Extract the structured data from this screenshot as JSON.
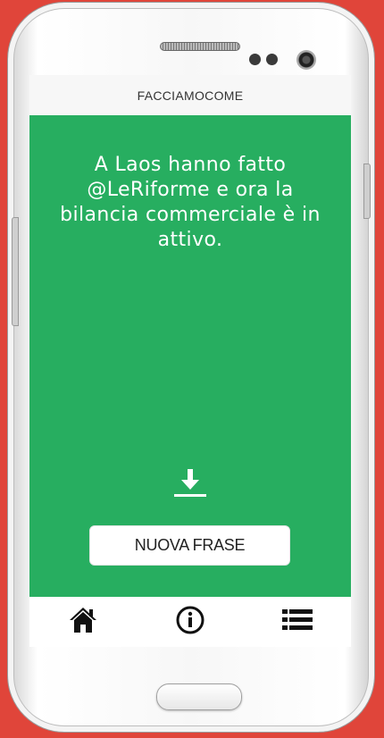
{
  "app": {
    "title": "FACCIAMOCOME"
  },
  "main": {
    "quote": "A Laos hanno fatto @LeRiforme e ora la bilancia commerciale è in attivo.",
    "download_icon": "download-icon",
    "new_phrase_label": "NUOVA FRASE"
  },
  "nav": {
    "items": [
      {
        "icon": "home-icon"
      },
      {
        "icon": "info-icon"
      },
      {
        "icon": "list-icon"
      }
    ]
  },
  "colors": {
    "background": "#e0453a",
    "accent": "#27ae60",
    "topbar": "#f7f7f7"
  }
}
